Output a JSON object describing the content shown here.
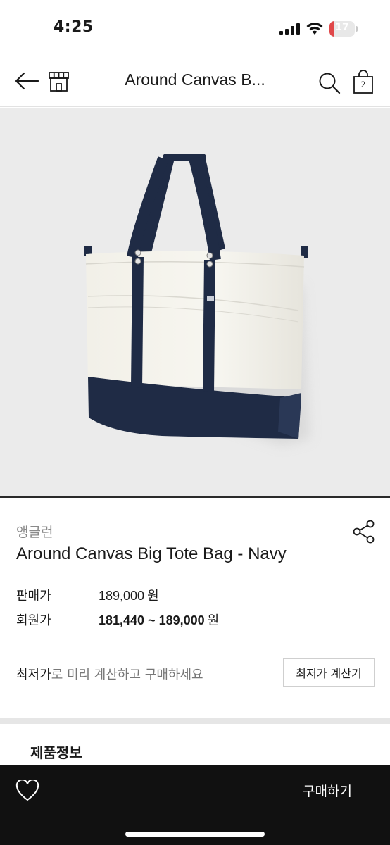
{
  "status_bar": {
    "time": "4:25",
    "battery_level": "17",
    "battery_fraction": 0.17,
    "battery_color": "#e0484a"
  },
  "nav": {
    "back_icon": "arrow-left-icon",
    "store_icon": "storefront-icon",
    "title": "Around Canvas B...",
    "search_icon": "search-icon",
    "cart_icon": "shopping-bag-icon",
    "cart_count": "2"
  },
  "product": {
    "image_description_icon": "tote-bag-image",
    "brand": "앵글런",
    "name": "Around Canvas Big Tote Bag - Navy",
    "share_icon": "share-icon",
    "price_label": "판매가",
    "price_value": "189,000",
    "member_price_label": "회원가",
    "member_price_value": "181,440 ~ 189,000",
    "currency": "원"
  },
  "lowest_price": {
    "highlight": "최저가",
    "text": "로 미리 계산하고 구매하세요",
    "button_label": "최저가 계산기"
  },
  "section": {
    "title": "제품정보"
  },
  "bottom_bar": {
    "wishlist_icon": "heart-icon",
    "buy_label": "구매하기"
  },
  "colors": {
    "accent_navy": "#1f2b45",
    "bottom_bar": "#111111",
    "image_background": "#ebebeb"
  }
}
